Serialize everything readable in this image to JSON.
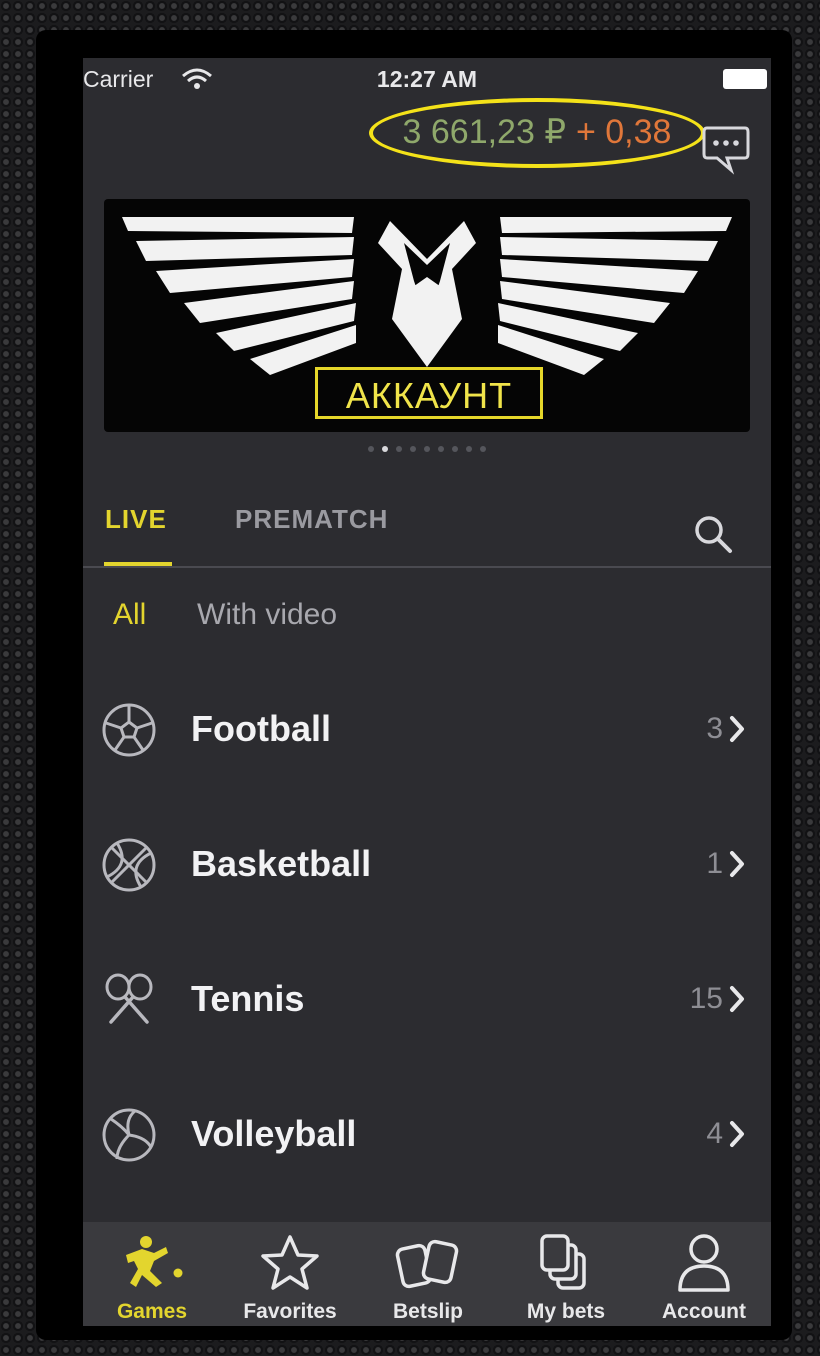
{
  "status_bar": {
    "carrier": "Carrier",
    "time": "12:27 AM"
  },
  "header": {
    "balance": "3 661,23 ₽",
    "delta": "+ 0,38",
    "highlight_color": "#f4e219"
  },
  "banner": {
    "label": "АККАУНТ",
    "slides": 9,
    "active_slide": 2
  },
  "tabs": [
    {
      "label": "LIVE",
      "active": true
    },
    {
      "label": "PREMATCH",
      "active": false
    }
  ],
  "filters": [
    {
      "label": "All",
      "active": true
    },
    {
      "label": "With video",
      "active": false
    }
  ],
  "sports": [
    {
      "name": "Football",
      "count": "3",
      "icon": "football-icon"
    },
    {
      "name": "Basketball",
      "count": "1",
      "icon": "basketball-icon"
    },
    {
      "name": "Tennis",
      "count": "15",
      "icon": "tennis-icon"
    },
    {
      "name": "Volleyball",
      "count": "4",
      "icon": "volleyball-icon"
    }
  ],
  "tabbar": [
    {
      "label": "Games",
      "icon": "games-icon",
      "active": true
    },
    {
      "label": "Favorites",
      "icon": "star-icon",
      "active": false
    },
    {
      "label": "Betslip",
      "icon": "betslip-icon",
      "active": false
    },
    {
      "label": "My bets",
      "icon": "my-bets-icon",
      "active": false
    },
    {
      "label": "Account",
      "icon": "account-icon",
      "active": false
    }
  ],
  "colors": {
    "accent": "#e3d52e",
    "balance": "#8fa86b",
    "delta": "#e0773a",
    "background": "#2c2c30"
  }
}
